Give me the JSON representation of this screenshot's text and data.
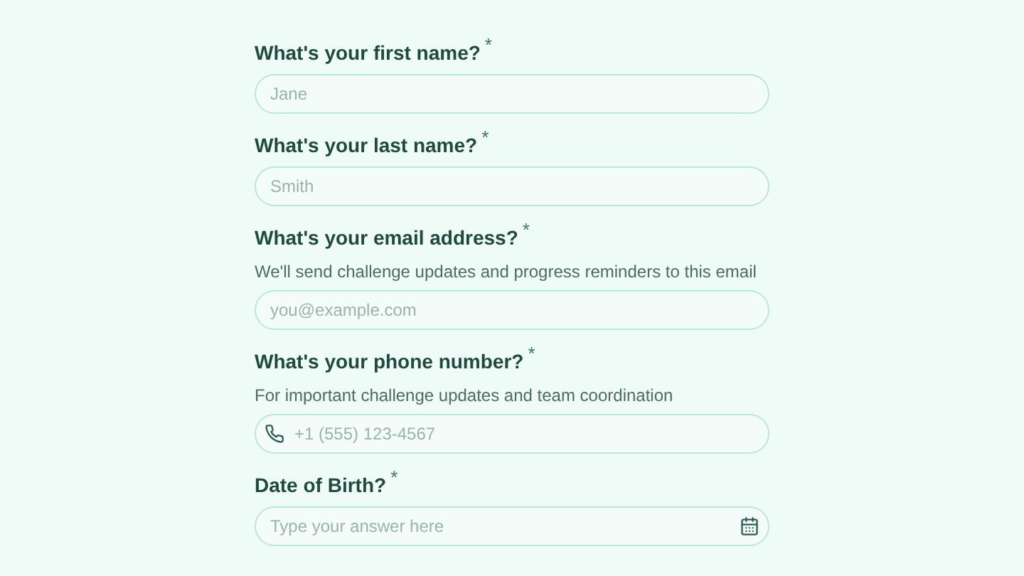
{
  "questions": [
    {
      "kind": "text",
      "label": "What's your first name?",
      "required_mark": "*",
      "placeholder": "Jane"
    },
    {
      "kind": "text",
      "label": "What's your last name?",
      "required_mark": "*",
      "placeholder": "Smith"
    },
    {
      "kind": "text",
      "label": "What's your email address?",
      "required_mark": "*",
      "hint": "We'll send challenge updates and progress reminders to this email",
      "placeholder": "you@example.com"
    },
    {
      "kind": "phone",
      "label": "What's your phone number?",
      "required_mark": "*",
      "hint": "For important challenge updates and team coordination",
      "placeholder": "+1 (555) 123-4567"
    },
    {
      "kind": "date",
      "label": "Date of Birth?",
      "required_mark": "*",
      "placeholder": "Type your answer here"
    }
  ]
}
